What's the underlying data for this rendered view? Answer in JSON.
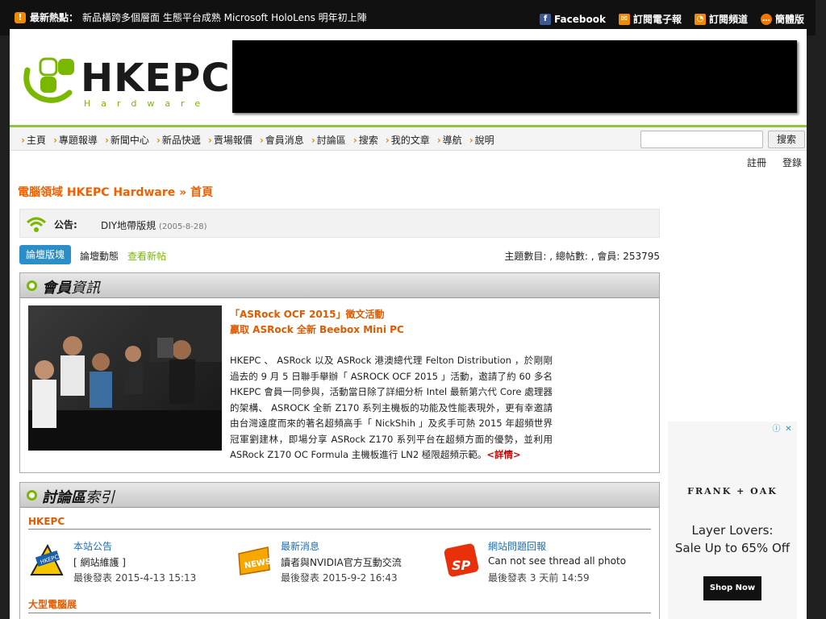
{
  "topbar": {
    "hot_label": "最新熱點：",
    "hot_text": "新品橫跨多個層面 生態平台成熟 Microsoft HoloLens 明年初上陣",
    "facebook": "Facebook",
    "subscribe_news": "訂閱電子報",
    "subscribe_channel": "訂閱頻道",
    "simplified": "簡體版"
  },
  "logo": {
    "word": "HKEPC",
    "sub": "Hardware"
  },
  "nav": {
    "items": [
      "主頁",
      "專題報導",
      "新聞中心",
      "新品快遞",
      "賣場報價",
      "會員消息",
      "討論區",
      "搜索",
      "我的文章",
      "導航",
      "說明"
    ],
    "search_placeholder": "",
    "search_button": "搜索"
  },
  "auth": {
    "register": "註冊",
    "login": "登錄"
  },
  "breadcrumb": "電腦領域 HKEPC Hardware » 首頁",
  "announcement": {
    "label": "公告:",
    "text": "DIY地帶版規",
    "date": "(2005-8-28)"
  },
  "tabs": {
    "active": "論壇版塊",
    "second": "論壇動態",
    "third": "查看新帖",
    "stats": "主題數目: , 總帖數: , 會員: 253795"
  },
  "member_panel": {
    "title_bold": "會員",
    "title_rest": "資訊",
    "headline1": "「ASRock OCF 2015」徵文活動",
    "headline2": "贏取 ASRock 全新 Beebox Mini PC",
    "body": "HKEPC 、 ASRock 以及 ASRock 港澳總代理 Felton Distribution ，於剛剛過去的 9 月 5 日聯手舉辦「 ASROCK OCF 2015 」活動，邀請了約 60 多名 HKEPC 會員一同參與，活動當日除了詳細分析 Intel 最新第六代 Core 處理器的架構、 ASROCK 全新 Z170 系列主機板的功能及性能表現外，更有幸邀請由台灣遠度而來的著名超頻高手「 NickShih 」及炙手可熱 2015 年超頻世界冠軍劉建林，即場分享 ASRock Z170 系列平台在超頻方面的優勢，並利用 ASRock Z170 OC Formula 主機板進行 LN2 極限超頻示範。",
    "more": "<詳情>"
  },
  "forum_panel": {
    "title_bold": "討論區",
    "title_rest": "索引",
    "section1": "HKEPC",
    "section2": "大型電腦展",
    "forums": [
      {
        "name": "本站公告",
        "last": "[ 網站維護 ]",
        "time": "最後發表 2015-4-13 15:13",
        "img": "HKEPC"
      },
      {
        "name": "最新消息",
        "last": "讀者與NVIDIA官方互動交流",
        "time": "最後發表 2015-9-2 16:43",
        "img": "NEWS"
      },
      {
        "name": "網站問題回報",
        "last": "Can not see thread all photo",
        "time": "最後發表 3 天前 14:59",
        "img": "SP"
      }
    ]
  },
  "ad": {
    "brand": "FRANK + OAK",
    "headline1": "Layer Lovers:",
    "headline2": "Sale Up to 65% Off",
    "cta": "Shop Now"
  }
}
